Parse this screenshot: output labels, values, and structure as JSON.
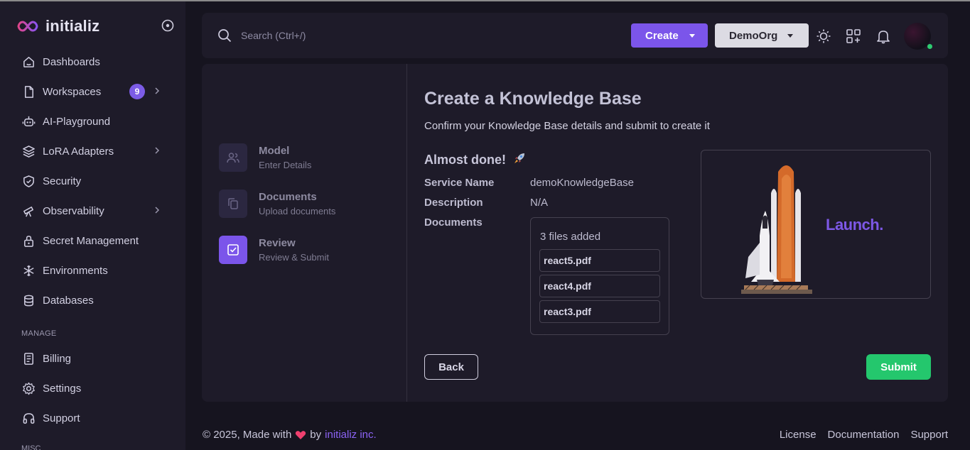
{
  "brand": {
    "name": "initializ"
  },
  "sidebar": {
    "items": [
      {
        "label": "Dashboards",
        "icon": "home-icon"
      },
      {
        "label": "Workspaces",
        "icon": "file-icon",
        "badge": "9",
        "chevron": true
      },
      {
        "label": "AI-Playground",
        "icon": "robot-icon"
      },
      {
        "label": "LoRA Adapters",
        "icon": "layers-icon",
        "chevron": true
      },
      {
        "label": "Security",
        "icon": "shield-icon"
      },
      {
        "label": "Observability",
        "icon": "telescope-icon",
        "chevron": true
      },
      {
        "label": "Secret Management",
        "icon": "lock-icon"
      },
      {
        "label": "Environments",
        "icon": "snowflake-icon"
      },
      {
        "label": "Databases",
        "icon": "database-icon"
      }
    ],
    "manage_label": "MANAGE",
    "manage_items": [
      {
        "label": "Billing",
        "icon": "receipt-icon"
      },
      {
        "label": "Settings",
        "icon": "gear-icon"
      },
      {
        "label": "Support",
        "icon": "headset-icon"
      }
    ],
    "misc_label": "MISC"
  },
  "header": {
    "search_placeholder": "Search (Ctrl+/)",
    "create_label": "Create",
    "org_label": "DemoOrg"
  },
  "steps": [
    {
      "title": "Model",
      "subtitle": "Enter Details",
      "active": false
    },
    {
      "title": "Documents",
      "subtitle": "Upload documents",
      "active": false
    },
    {
      "title": "Review",
      "subtitle": "Review & Submit",
      "active": true
    }
  ],
  "review": {
    "title": "Create a Knowledge Base",
    "subtitle": "Confirm your Knowledge Base details and submit to create it",
    "almost_done": "Almost done!",
    "service_name_label": "Service Name",
    "service_name_value": "demoKnowledgeBase",
    "description_label": "Description",
    "description_value": "N/A",
    "documents_label": "Documents",
    "files_count": "3 files added",
    "files": [
      "react5.pdf",
      "react4.pdf",
      "react3.pdf"
    ],
    "launch_text": "Launch.",
    "back_label": "Back",
    "submit_label": "Submit"
  },
  "footer": {
    "copyright": "© 2025, Made with",
    "by": "by",
    "company": "initializ inc.",
    "links": [
      "License",
      "Documentation",
      "Support"
    ]
  },
  "colors": {
    "accent": "#7b55ea",
    "submit": "#24c76d",
    "background": "#16141f",
    "panel": "#1e1b29"
  }
}
